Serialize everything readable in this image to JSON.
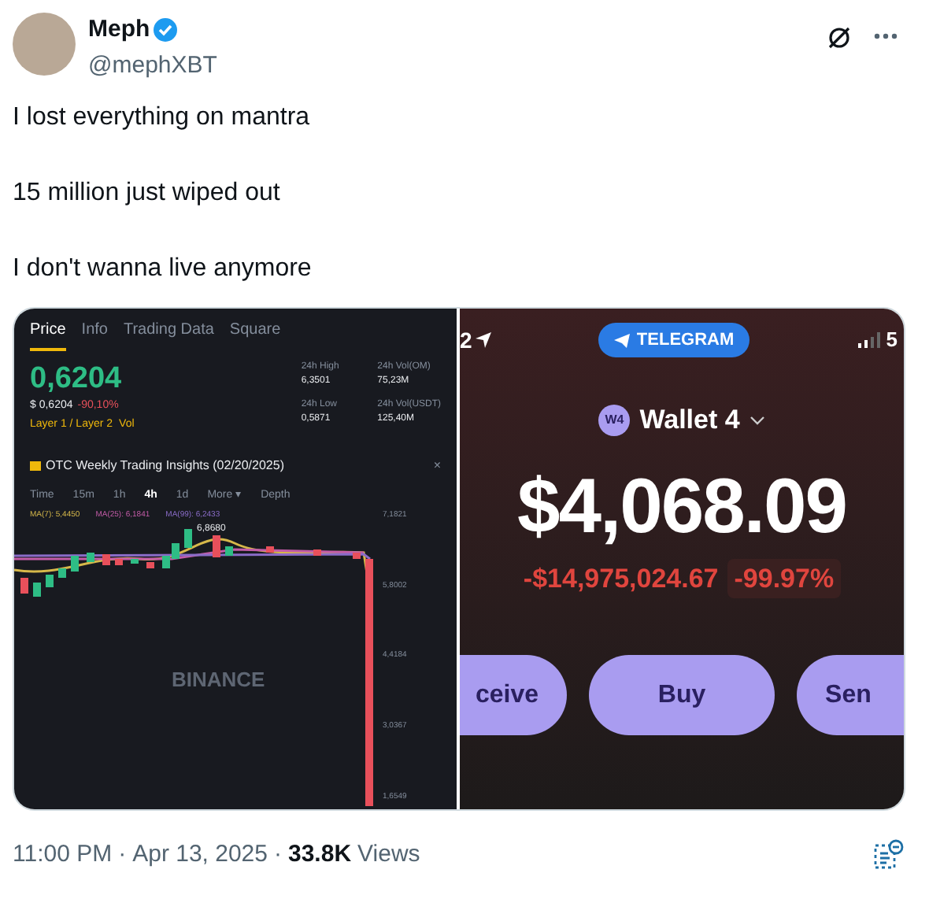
{
  "author": {
    "name": "Meph",
    "verified": true,
    "handle": "@mephXBT"
  },
  "text_lines": [
    "I lost everything on mantra",
    "15 million just wiped out",
    "I don't wanna live anymore"
  ],
  "exchange": {
    "tabs": [
      {
        "label": "Price",
        "selected": true
      },
      {
        "label": "Info",
        "selected": false
      },
      {
        "label": "Trading Data",
        "selected": false
      },
      {
        "label": "Square",
        "selected": false
      }
    ],
    "price": "0,6204",
    "usd_price": "$ 0,6204",
    "change": "-90,10%",
    "tags": [
      "Layer 1 / Layer 2",
      "Vol"
    ],
    "stats": [
      {
        "label": "24h High",
        "value": "6,3501"
      },
      {
        "label": "24h Vol(OM)",
        "value": "75,23M"
      },
      {
        "label": "24h Low",
        "value": "0,5871"
      },
      {
        "label": "24h Vol(USDT)",
        "value": "125,40M"
      }
    ],
    "banner": "OTC Weekly Trading Insights (02/20/2025)",
    "banner_close": "×",
    "intervals": [
      {
        "label": "Time",
        "selected": false
      },
      {
        "label": "15m",
        "selected": false
      },
      {
        "label": "1h",
        "selected": false
      },
      {
        "label": "4h",
        "selected": true
      },
      {
        "label": "1d",
        "selected": false
      },
      {
        "label": "More ▾",
        "selected": false
      },
      {
        "label": "Depth",
        "selected": false
      }
    ],
    "moving_averages": [
      {
        "label": "MA(7): 5,4450",
        "color": "#d6b84a"
      },
      {
        "label": "MA(25): 6,1841",
        "color": "#c45ca8"
      },
      {
        "label": "MA(99): 6,2433",
        "color": "#8a6cc8"
      }
    ],
    "high_marker": "6,8680",
    "y_labels": [
      "7,1821",
      "5,8002",
      "4,4184",
      "3,0367",
      "1,6549"
    ],
    "chart_watermark": "BINANCE"
  },
  "wallet": {
    "status_time": "2",
    "app_badge": "TELEGRAM",
    "network": "5",
    "wallet_badge": "W4",
    "wallet_name": "Wallet 4",
    "balance": "$4,068.09",
    "change_amount": "-$14,975,024.67",
    "change_percent": "-99.97%",
    "actions": [
      "ceive",
      "Buy",
      "Sen"
    ]
  },
  "footer": {
    "time": "11:00 PM",
    "separator": "·",
    "date": "Apr 13, 2025",
    "separator_2": "·",
    "views_count": "33.8K",
    "views_label": "Views"
  }
}
